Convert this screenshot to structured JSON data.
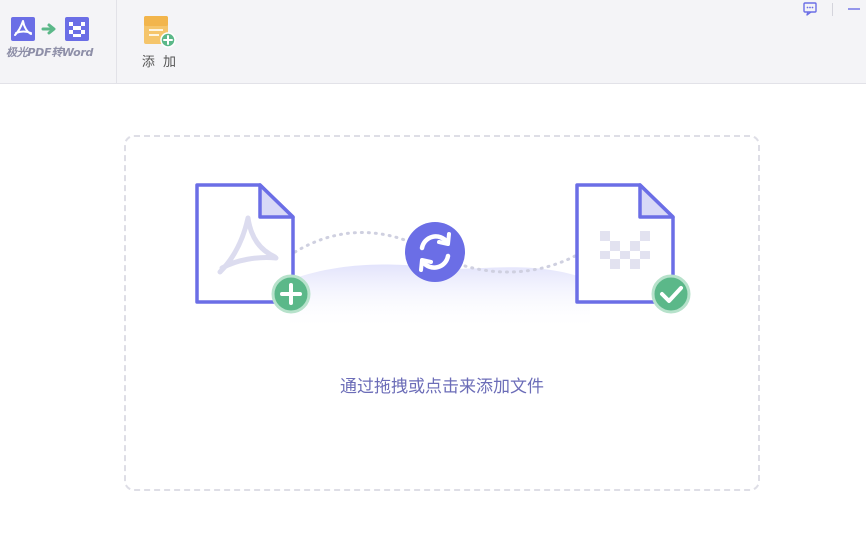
{
  "app": {
    "name": "极光PDF转Word"
  },
  "toolbar": {
    "add_label": "添 加"
  },
  "drop_zone": {
    "hint": "通过拖拽或点击来添加文件"
  },
  "colors": {
    "accent": "#6b6ee6",
    "success": "#5bb889",
    "toolbar_bg": "#f4f4f7",
    "folder": "#f5c56b"
  }
}
